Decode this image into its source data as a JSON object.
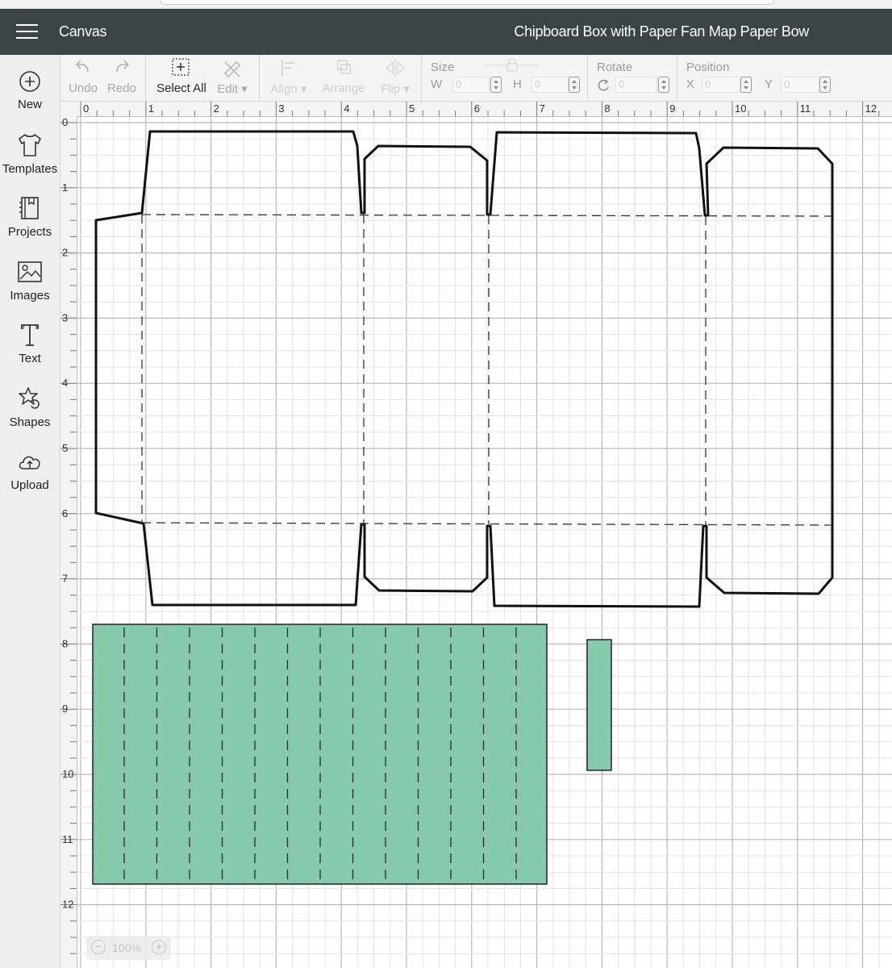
{
  "header": {
    "app_title": "Canvas",
    "project_name": "Chipboard Box with Paper Fan Map Paper Bow"
  },
  "sidebar": {
    "items": [
      {
        "label": "New",
        "icon": "plus-circle-icon"
      },
      {
        "label": "Templates",
        "icon": "shirt-icon"
      },
      {
        "label": "Projects",
        "icon": "book-icon"
      },
      {
        "label": "Images",
        "icon": "image-icon"
      },
      {
        "label": "Text",
        "icon": "text-icon"
      },
      {
        "label": "Shapes",
        "icon": "shapes-icon"
      },
      {
        "label": "Upload",
        "icon": "upload-cloud-icon"
      }
    ]
  },
  "toolbar": {
    "undo": "Undo",
    "redo": "Redo",
    "select_all": "Select All",
    "edit": "Edit",
    "align": "Align",
    "arrange": "Arrange",
    "flip": "Flip",
    "size_label": "Size",
    "w_label": "W",
    "h_label": "H",
    "w_value": "0",
    "h_value": "0",
    "rotate_label": "Rotate",
    "rotate_value": "0",
    "position_label": "Position",
    "x_label": "X",
    "y_label": "Y",
    "x_value": "0",
    "y_value": "0"
  },
  "rulers": {
    "horizontal": [
      "0",
      "1",
      "2",
      "3",
      "4",
      "5",
      "6",
      "7",
      "8",
      "9",
      "10",
      "11",
      "12"
    ],
    "vertical": [
      "0",
      "1",
      "2",
      "3",
      "4",
      "5",
      "6",
      "7",
      "8",
      "9",
      "10",
      "11",
      "12"
    ]
  },
  "canvas": {
    "fill_color": "#86c9ac",
    "grid_major_color": "#b9b9b9",
    "grid_minor_color": "#e3e3e3"
  },
  "zoom": {
    "value": "100%"
  }
}
